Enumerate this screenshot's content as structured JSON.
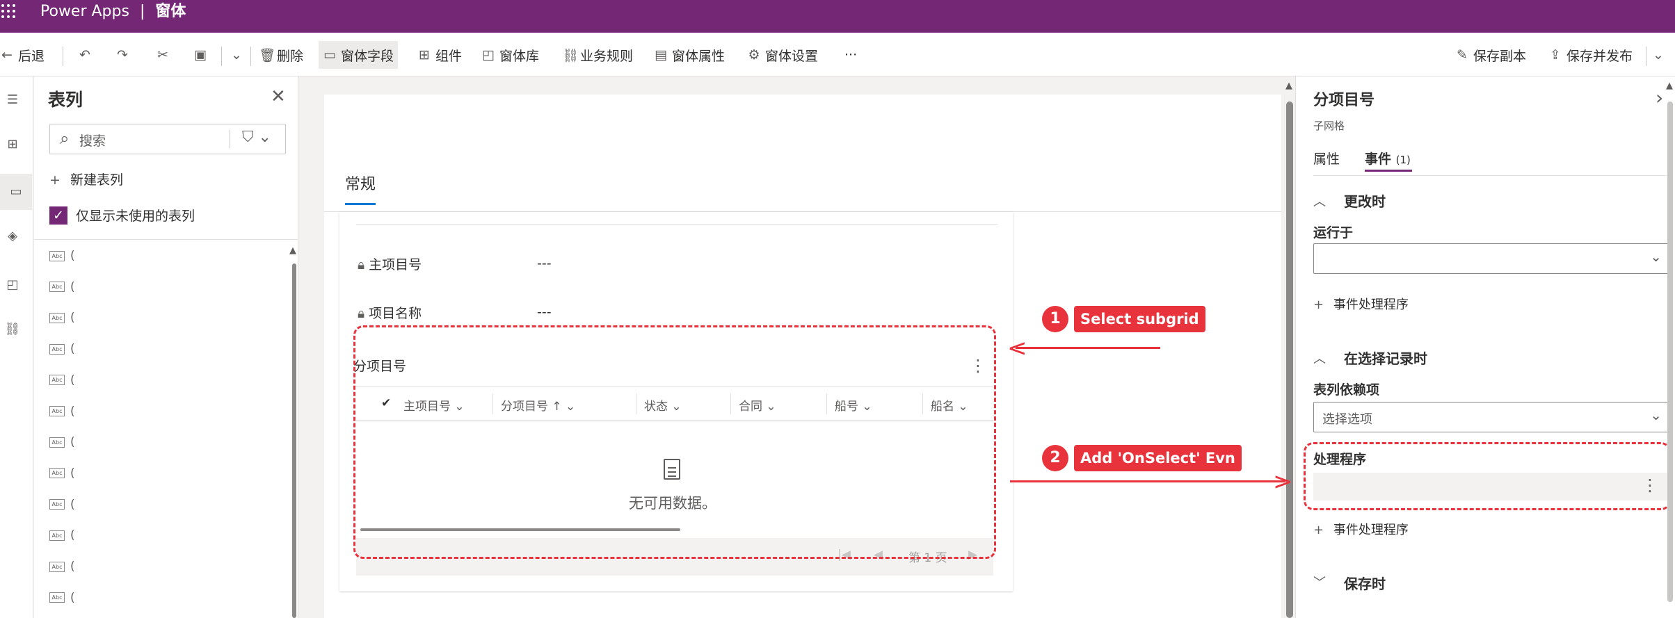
{
  "app": {
    "product": "Power Apps",
    "separator": "|",
    "page": "窗体"
  },
  "toolbar": {
    "back": "后退",
    "delete": "删除",
    "form_fields": "窗体字段",
    "components": "组件",
    "form_library": "窗体库",
    "business_rules": "业务规则",
    "form_properties": "窗体属性",
    "form_settings": "窗体设置",
    "more": "···",
    "save_copy": "保存副本",
    "save_publish": "保存并发布"
  },
  "column_panel": {
    "title": "表列",
    "search_placeholder": "搜索",
    "new_column": "新建表列",
    "only_unused": "仅显示未使用的表列",
    "items": [
      "(",
      "(",
      "(",
      "(",
      "(",
      "(",
      "(",
      "(",
      "(",
      "(",
      "(",
      "("
    ]
  },
  "form": {
    "tab": "常规",
    "fields": [
      {
        "label": "主项目号",
        "value": "---"
      },
      {
        "label": "项目名称",
        "value": "---"
      }
    ],
    "subgrid": {
      "title": "分项目号",
      "columns": [
        "主项目号",
        "分项目号 ↑",
        "状态",
        "合同",
        "船号",
        "船名"
      ],
      "empty_text": "无可用数据。",
      "page_label": "第 1 页"
    }
  },
  "annotations": [
    {
      "num": "1",
      "text": "Select subgrid"
    },
    {
      "num": "2",
      "text": "Add 'OnSelect' Evn"
    }
  ],
  "properties": {
    "title": "分项目号",
    "subtitle": "子网格",
    "tab_properties": "属性",
    "tab_events": "事件",
    "tab_events_count": "(1)",
    "on_change": {
      "heading": "更改时",
      "run_on_label": "运行于",
      "add_handler": "事件处理程序"
    },
    "on_record_select": {
      "heading": "在选择记录时",
      "dependency_label": "表列依赖项",
      "dependency_placeholder": "选择选项",
      "handler_label": "处理程序",
      "add_handler": "事件处理程序"
    },
    "on_save": {
      "heading": "保存时"
    }
  },
  "colors": {
    "brand": "#742774",
    "accent": "#0078d4",
    "annotation": "#e8323c"
  }
}
